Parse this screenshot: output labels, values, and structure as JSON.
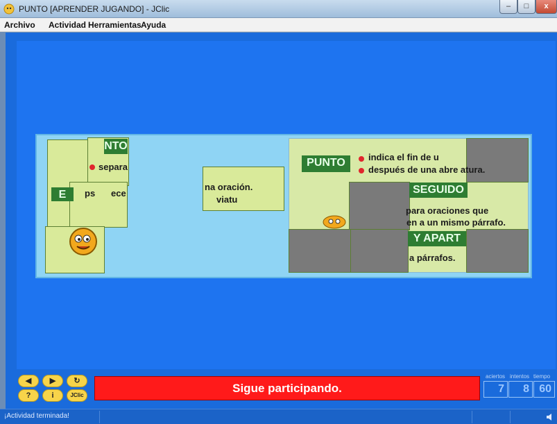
{
  "window": {
    "title": "PUNTO [APRENDER JUGANDO] - JClic",
    "minimize": "–",
    "maximize": "□",
    "close": "x"
  },
  "menu": [
    "Archivo",
    "Actividad",
    "Herramientas",
    "Ayuda"
  ],
  "puzzle": {
    "labels": [
      "PUNTO",
      "SEGUIDO",
      "Y APART",
      "NTO",
      "E"
    ],
    "texts": [
      "indica el fin de u",
      "después de una abre   atura.",
      "para oraciones que",
      "en a un mismo párrafo.",
      "a párrafos.",
      "separa",
      "ps",
      "ece",
      "na oración.",
      "viatu"
    ]
  },
  "controls": {
    "prev": "◀",
    "next": "▶",
    "restart": "↻",
    "help": "?",
    "info": "i",
    "jclic": "JClic"
  },
  "message": "Sigue participando.",
  "counters": {
    "labels": [
      "aciertos",
      "intentos",
      "tiempo"
    ],
    "values": [
      "7",
      "8",
      "60"
    ]
  },
  "statusbar": {
    "text": "¡Actividad terminada!"
  },
  "colors": {
    "background": "#1a6bdc",
    "message_bg": "#ff1a1a",
    "control_button": "#f7d44a"
  }
}
